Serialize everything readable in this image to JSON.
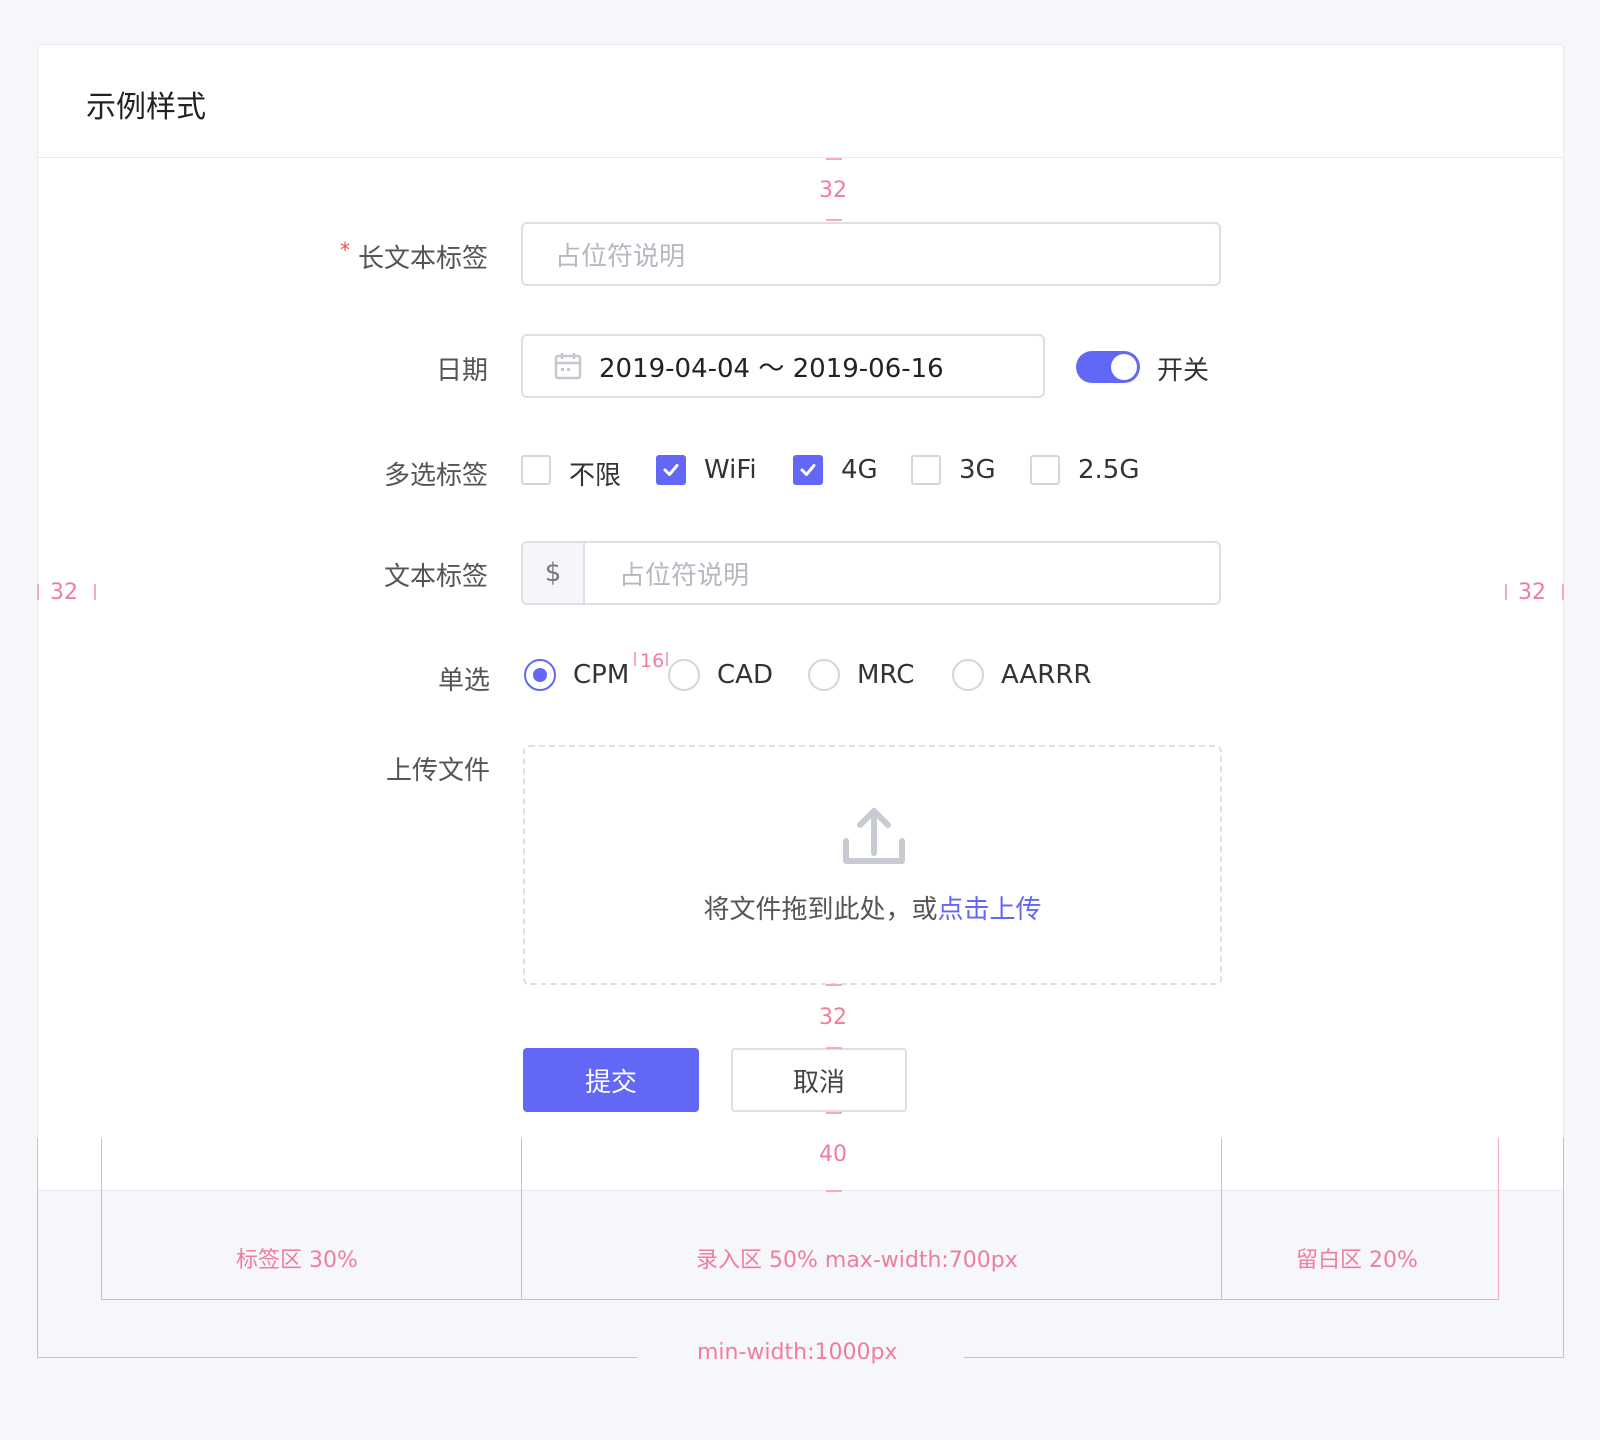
{
  "card": {
    "title": "示例样式"
  },
  "form": {
    "long_label": {
      "required_mark": "*",
      "label": "长文本标签",
      "placeholder": "占位符说明"
    },
    "date": {
      "label": "日期",
      "value": "2019-04-04 ～ 2019-06-16"
    },
    "switch": {
      "label": "开关",
      "on": true
    },
    "multi": {
      "label": "多选标签",
      "options": [
        {
          "text": "不限",
          "checked": false
        },
        {
          "text": "WiFi",
          "checked": true
        },
        {
          "text": "4G",
          "checked": true
        },
        {
          "text": "3G",
          "checked": false
        },
        {
          "text": "2.5G",
          "checked": false
        }
      ]
    },
    "text_label": {
      "label": "文本标签",
      "prefix": "$",
      "placeholder": "占位符说明"
    },
    "radio": {
      "label": "单选",
      "options": [
        {
          "text": "CPM",
          "selected": true
        },
        {
          "text": "CAD",
          "selected": false
        },
        {
          "text": "MRC",
          "selected": false
        },
        {
          "text": "AARRR",
          "selected": false
        }
      ]
    },
    "upload": {
      "label": "上传文件",
      "text": "将文件拖到此处，或",
      "link": "点击上传"
    },
    "buttons": {
      "submit": "提交",
      "cancel": "取消"
    }
  },
  "annotations": {
    "spacing_top": "32",
    "spacing_left": "32",
    "spacing_right": "32",
    "spacing_radio": "16",
    "spacing_upload": "32",
    "spacing_bottom": "40",
    "label_zone": "标签区 30%",
    "input_zone": "录入区 50% max-width:700px",
    "blank_zone": "留白区 20%",
    "min_width": "min-width:1000px"
  },
  "colors": {
    "primary": "#6367f5",
    "annotation": "#f17d9b",
    "required": "#f24b4b"
  }
}
